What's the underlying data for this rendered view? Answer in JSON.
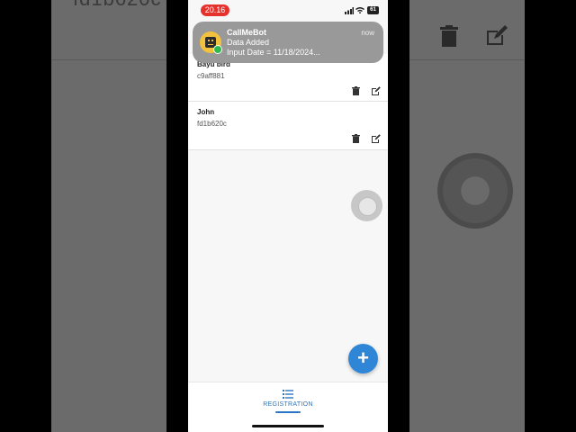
{
  "background": {
    "ghost_text": "fd1b620c"
  },
  "status_bar": {
    "time": "20.16",
    "battery": "61"
  },
  "notification": {
    "app_name": "CallMeBot",
    "time": "now",
    "title": "Data Added",
    "body": "Input Date = 11/18/2024..."
  },
  "items": [
    {
      "name": "Bayu bird",
      "code": "c9aff881"
    },
    {
      "name": "John",
      "code": "fd1b620c"
    }
  ],
  "fab": {
    "label": "+"
  },
  "bottom_nav": {
    "label": "REGISTRATION"
  },
  "colors": {
    "accent": "#2f86d6",
    "nav_active": "#2a76c2",
    "time_pill": "#e5322d",
    "whatsapp": "#2fb84b"
  }
}
